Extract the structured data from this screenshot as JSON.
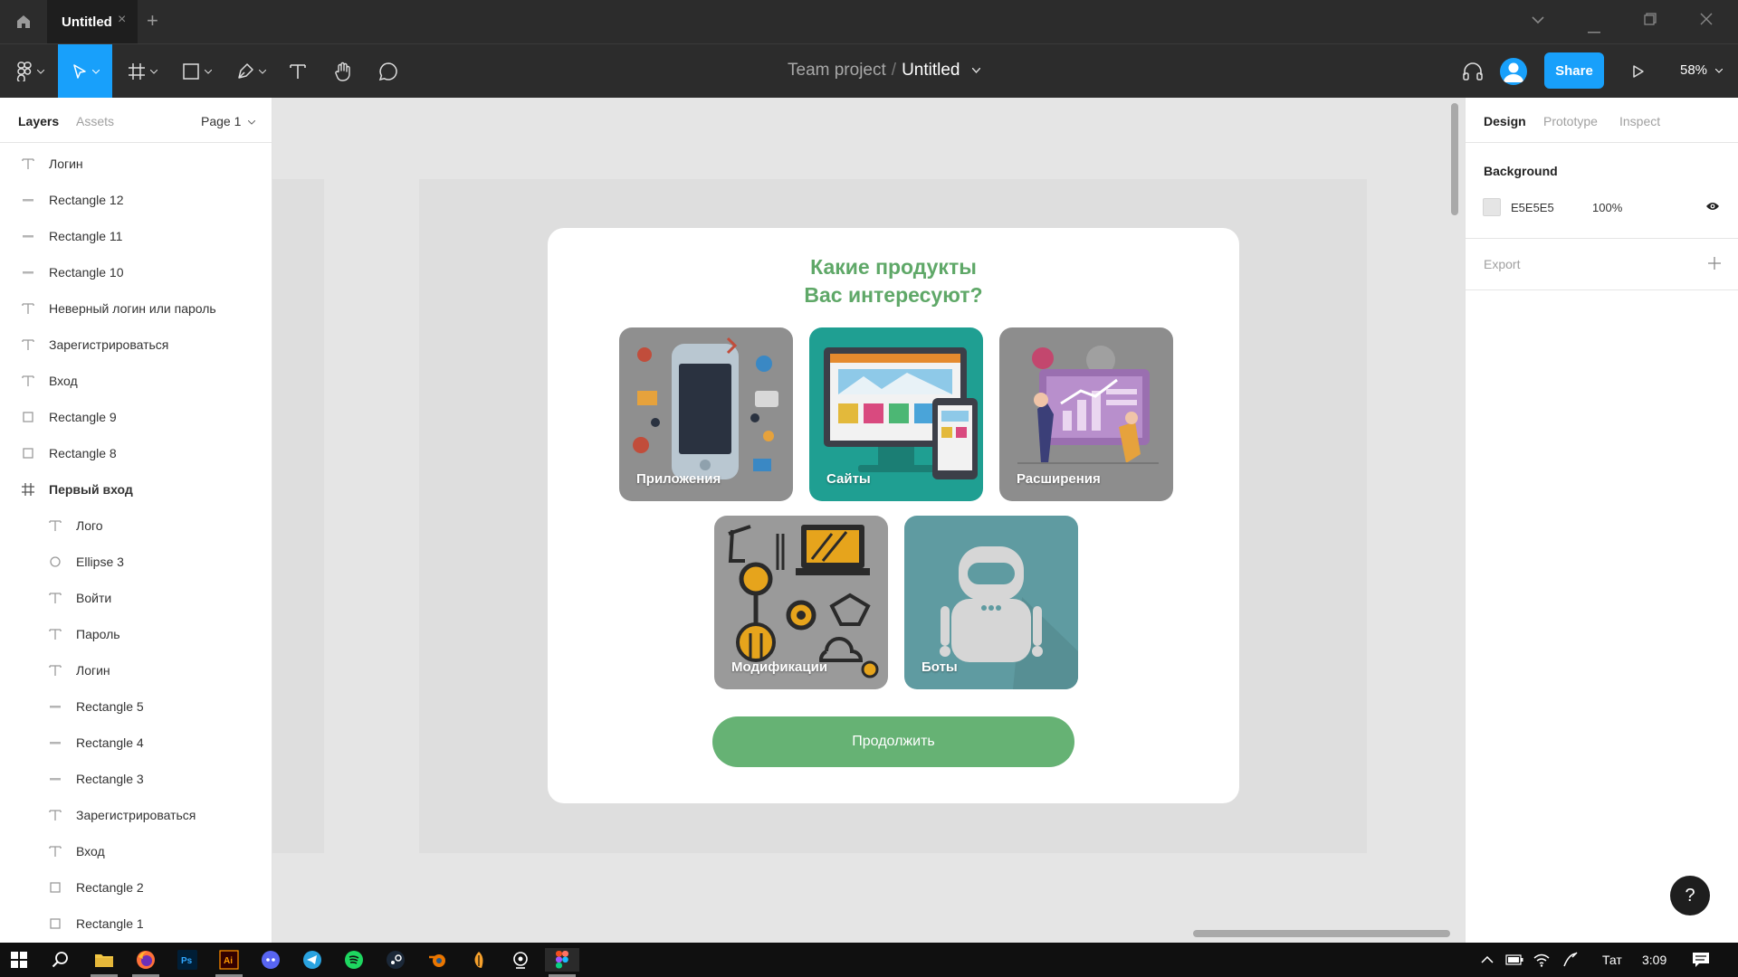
{
  "titlebar": {
    "tab_label": "Untitled",
    "close_glyph": "×",
    "new_tab_glyph": "+"
  },
  "toolbar": {
    "breadcrumb_project": "Team project",
    "breadcrumb_separator": "/",
    "breadcrumb_file": "Untitled",
    "share_label": "Share",
    "zoom_label": "58%"
  },
  "left_panel": {
    "tabs": [
      "Layers",
      "Assets"
    ],
    "page_label": "Page 1",
    "layers": [
      {
        "name": "Логин",
        "type": "text",
        "indent": 0
      },
      {
        "name": "Rectangle 12",
        "type": "line",
        "indent": 0
      },
      {
        "name": "Rectangle 11",
        "type": "line",
        "indent": 0
      },
      {
        "name": "Rectangle 10",
        "type": "line",
        "indent": 0
      },
      {
        "name": "Неверный логин или пароль",
        "type": "text",
        "indent": 0
      },
      {
        "name": "Зарегистрироваться",
        "type": "text",
        "indent": 0
      },
      {
        "name": "Вход",
        "type": "text",
        "indent": 0
      },
      {
        "name": "Rectangle 9",
        "type": "rect",
        "indent": 0
      },
      {
        "name": "Rectangle 8",
        "type": "rect",
        "indent": 0
      },
      {
        "name": "Первый вход",
        "type": "frame",
        "indent": 0
      },
      {
        "name": "Лого",
        "type": "text",
        "indent": 1
      },
      {
        "name": "Ellipse 3",
        "type": "ellipse",
        "indent": 1
      },
      {
        "name": "Войти",
        "type": "text",
        "indent": 1
      },
      {
        "name": "Пароль",
        "type": "text",
        "indent": 1
      },
      {
        "name": "Логин",
        "type": "text",
        "indent": 1
      },
      {
        "name": "Rectangle 5",
        "type": "line",
        "indent": 1
      },
      {
        "name": "Rectangle 4",
        "type": "line",
        "indent": 1
      },
      {
        "name": "Rectangle 3",
        "type": "line",
        "indent": 1
      },
      {
        "name": "Зарегистрироваться",
        "type": "text",
        "indent": 1
      },
      {
        "name": "Вход",
        "type": "text",
        "indent": 1
      },
      {
        "name": "Rectangle 2",
        "type": "rect",
        "indent": 1
      },
      {
        "name": "Rectangle 1",
        "type": "rect",
        "indent": 1
      }
    ]
  },
  "canvas": {
    "card_title_line1": "Какие продукты",
    "card_title_line2": "Вас интересуют?",
    "tiles": [
      {
        "label": "Приложения",
        "color": "#8f8f8f"
      },
      {
        "label": "Сайты",
        "color": "#1f9f92"
      },
      {
        "label": "Расширения",
        "color": "#8d8d8d"
      },
      {
        "label": "Модификации",
        "color": "#9a9a9a"
      },
      {
        "label": "Боты",
        "color": "#5f9ba1"
      }
    ],
    "continue_label": "Продолжить",
    "title_color": "#5fa868",
    "button_color": "#66b274"
  },
  "right_panel": {
    "tabs": [
      "Design",
      "Prototype",
      "Inspect"
    ],
    "background_label": "Background",
    "background_hex": "E5E5E5",
    "background_opacity": "100%",
    "export_label": "Export",
    "help_label": "?"
  },
  "taskbar": {
    "language": "Тат",
    "time": "3:09"
  },
  "colors": {
    "accent": "#18a0fb",
    "dark_chrome": "#2c2c2c",
    "canvas_bg": "#e5e5e5"
  }
}
